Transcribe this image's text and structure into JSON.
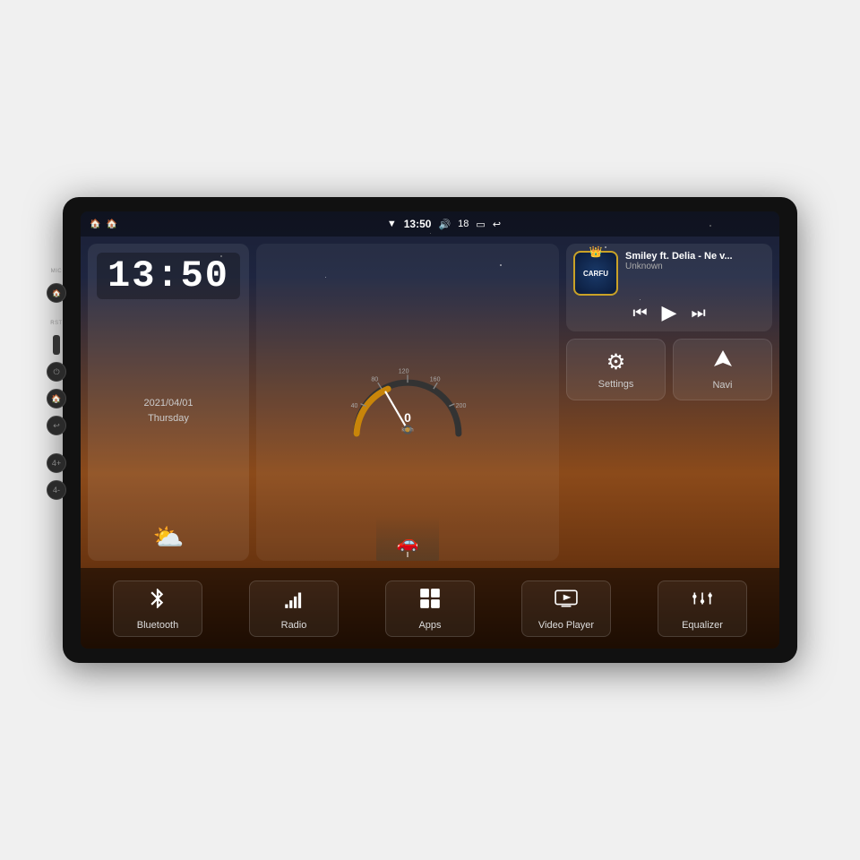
{
  "device": {
    "title": "Car Head Unit"
  },
  "status_bar": {
    "left_icons": [
      "🏠",
      "🏠"
    ],
    "time": "13:50",
    "volume_icon": "🔊",
    "volume_level": "18",
    "signal_icon": "▼",
    "battery_icon": "🔋",
    "back_icon": "↩"
  },
  "clock_widget": {
    "time": "13:50",
    "date_line1": "2021/04/01",
    "date_line2": "Thursday",
    "weather": "⛅"
  },
  "music_widget": {
    "logo_text": "CARFU",
    "title": "Smiley ft. Delia - Ne v...",
    "artist": "Unknown",
    "prev_icon": "⏮",
    "play_icon": "▶",
    "next_icon": "⏭"
  },
  "settings_button": {
    "label": "Settings",
    "icon": "⚙"
  },
  "navi_button": {
    "label": "Navi",
    "icon": "▲"
  },
  "app_bar": {
    "items": [
      {
        "id": "bluetooth",
        "label": "Bluetooth",
        "icon": "Ƀ"
      },
      {
        "id": "radio",
        "label": "Radio",
        "icon": "📶"
      },
      {
        "id": "apps",
        "label": "Apps",
        "icon": "⊞"
      },
      {
        "id": "video-player",
        "label": "Video Player",
        "icon": "📺"
      },
      {
        "id": "equalizer",
        "label": "Equalizer",
        "icon": "🎚"
      }
    ]
  },
  "speedometer": {
    "speed": "0",
    "unit": "km/h",
    "max": "240"
  }
}
